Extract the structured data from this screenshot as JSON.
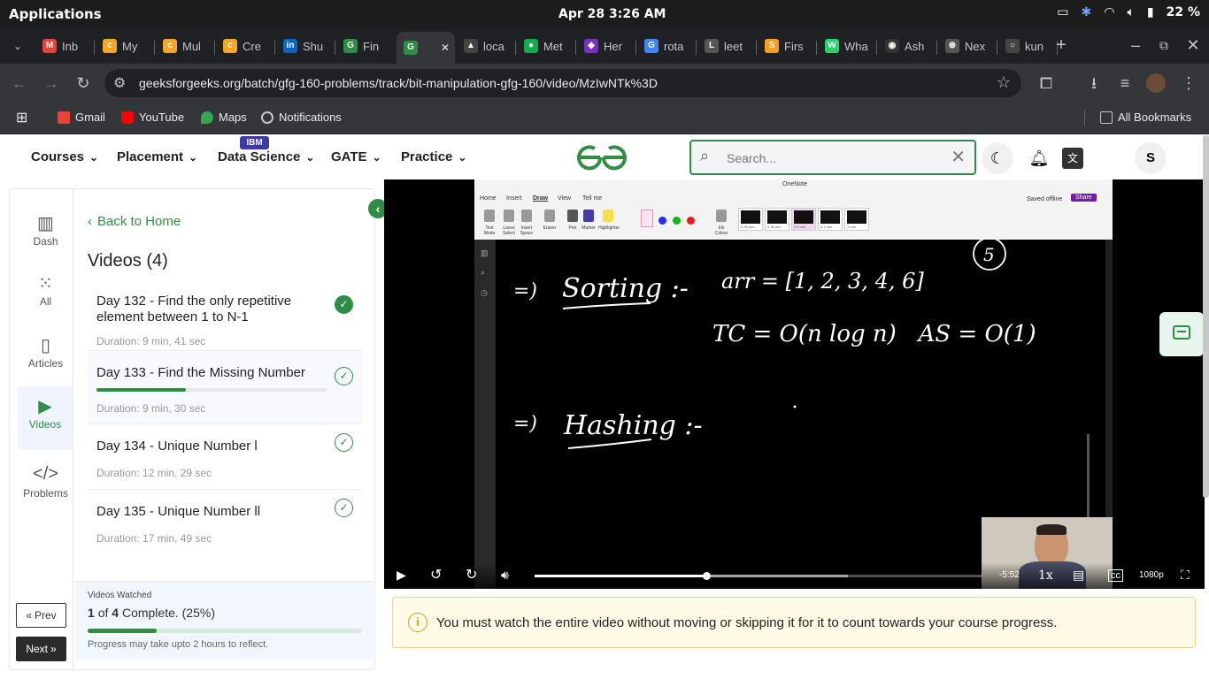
{
  "os": {
    "apps_label": "Applications",
    "clock": "Apr 28  3:26 AM",
    "battery": "22 %"
  },
  "tabs": [
    {
      "label": "Inb",
      "color": "#ea4335",
      "glyph": "M"
    },
    {
      "label": "My",
      "color": "#f5a623",
      "glyph": "c"
    },
    {
      "label": "Mul",
      "color": "#f5a623",
      "glyph": "c"
    },
    {
      "label": "Cre",
      "color": "#f5a623",
      "glyph": "c"
    },
    {
      "label": "Shu",
      "color": "#0a66c2",
      "glyph": "in"
    },
    {
      "label": "Fin",
      "color": "#2f8d46",
      "glyph": "G"
    },
    {
      "label": "",
      "color": "#2f8d46",
      "glyph": "G"
    },
    {
      "label": "loca",
      "color": "#444",
      "glyph": "▲"
    },
    {
      "label": "Met",
      "color": "#13aa52",
      "glyph": "●"
    },
    {
      "label": "Her",
      "color": "#7b2fbe",
      "glyph": "◆"
    },
    {
      "label": "rota",
      "color": "#4285f4",
      "glyph": "G"
    },
    {
      "label": "leet",
      "color": "#555",
      "glyph": "L"
    },
    {
      "label": "Firs",
      "color": "#f89f1b",
      "glyph": "S"
    },
    {
      "label": "Wha",
      "color": "#25d366",
      "glyph": "W"
    },
    {
      "label": "Ash",
      "color": "#333",
      "glyph": "◉"
    },
    {
      "label": "Nex",
      "color": "#555",
      "glyph": "⊛"
    },
    {
      "label": "kun",
      "color": "#444",
      "glyph": "○"
    }
  ],
  "address": {
    "url": "geeksforgeeks.org/batch/gfg-160-problems/track/bit-manipulation-gfg-160/video/MzIwNTk%3D"
  },
  "bookmarks": {
    "items": [
      "Gmail",
      "YouTube",
      "Maps",
      "Notifications"
    ],
    "all_label": "All Bookmarks"
  },
  "header": {
    "nav": [
      "Courses",
      "Placement",
      "Data Science",
      "GATE",
      "Practice"
    ],
    "ibm_badge": "IBM",
    "search_placeholder": "Search...",
    "avatar_letter": "S",
    "brand_green": "#2f8d46"
  },
  "rail": {
    "items": [
      "Dash",
      "All",
      "Articles",
      "Videos",
      "Problems"
    ],
    "prev_label": "Prev",
    "next_label": "Next"
  },
  "playlist": {
    "back_label": "Back to Home",
    "title": "Videos (4)",
    "videos": [
      {
        "title": "Day 132 - Find the only repetitive element between 1 to N-1",
        "duration": "Duration: 9 min, 41 sec"
      },
      {
        "title": "Day 133 - Find the Missing Number",
        "duration": "Duration: 9 min, 30 sec",
        "progress": 0.39
      },
      {
        "title": "Day 134 - Unique Number l",
        "duration": "Duration: 12 min, 29 sec"
      },
      {
        "title": "Day 135 - Unique Number ll",
        "duration": "Duration: 17 min, 49 sec"
      }
    ],
    "watched": {
      "heading": "Videos Watched",
      "count": "1",
      "of_total": "of",
      "total": "4",
      "complete_text": "Complete. (25%)",
      "progress": 0.25,
      "note": "Progress may take upto 2 hours to reflect."
    }
  },
  "video": {
    "onenote": {
      "window_title": "OneNote",
      "tabs": [
        "Home",
        "Insert",
        "Draw",
        "View",
        "Tell me"
      ],
      "saved": "Saved offline",
      "share": "Share",
      "tools": [
        "Text Mode",
        "Lasso Select",
        "Insert Space",
        "Eraser",
        "Pen",
        "Marker",
        "Highlighter",
        "Ink Colour"
      ],
      "pen_sizes": [
        "0.25 mm",
        "0.35 mm",
        "0.5 mm",
        "0.7 mm",
        "1 mm"
      ],
      "ink": {
        "line1_bullet": "=)",
        "line1_word": "Sorting :-",
        "line1_expr": "arr = [1, 2, 3, 4, 6]",
        "circled": "5",
        "line2": "TC = O(n log n)   AS = O(1)",
        "line3_bullet": "=)",
        "line3_word": "Hashing :-"
      }
    },
    "time_remaining": "-5:52",
    "speed": "1x",
    "quality": "1080p",
    "played": 0.383,
    "buffered": 0.7
  },
  "notice": {
    "text": "You must watch the entire video without moving or skipping it for it to count towards your course progress."
  }
}
